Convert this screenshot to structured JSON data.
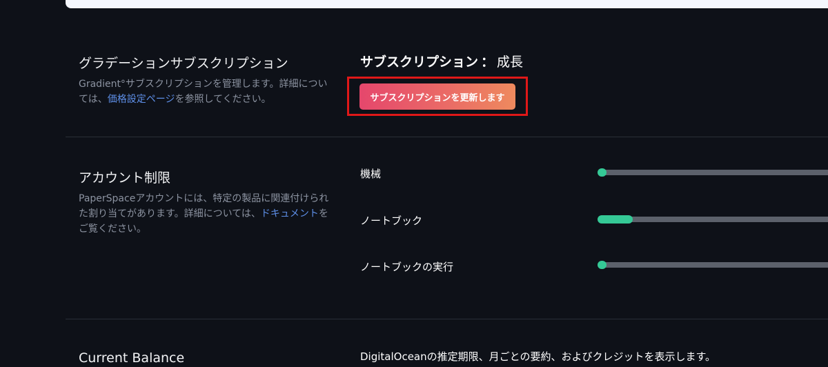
{
  "gradient_subscription": {
    "title": "グラデーションサブスクリプション",
    "desc_before": "Gradient°サブスクリプションを管理します。詳細については、",
    "desc_link": "価格設定ページ",
    "desc_after": "を参照してください。",
    "subscription_label": "サブスクリプション",
    "separator": "：",
    "plan_name": "成長",
    "update_button": "サブスクリプションを更新します",
    "highlight_color": "#e01818"
  },
  "account_limits": {
    "title": "アカウント制限",
    "desc_before": "PaperSpaceアカウントには、特定の製品に関連付けられた割り当てがあります。詳細については、",
    "desc_link": "ドキュメント",
    "desc_after": "をご覧ください。",
    "items": [
      {
        "label": "機械",
        "fill_fraction": 0.0
      },
      {
        "label": "ノートブック",
        "fill_fraction": 0.15
      },
      {
        "label": "ノートブックの実行",
        "fill_fraction": 0.0
      }
    ],
    "fill_color": "#35c996",
    "track_color": "#5c616b"
  },
  "current_balance": {
    "title": "Current Balance",
    "description": "DigitalOceanの推定期限、月ごとの要約、およびクレジットを表示します。"
  }
}
